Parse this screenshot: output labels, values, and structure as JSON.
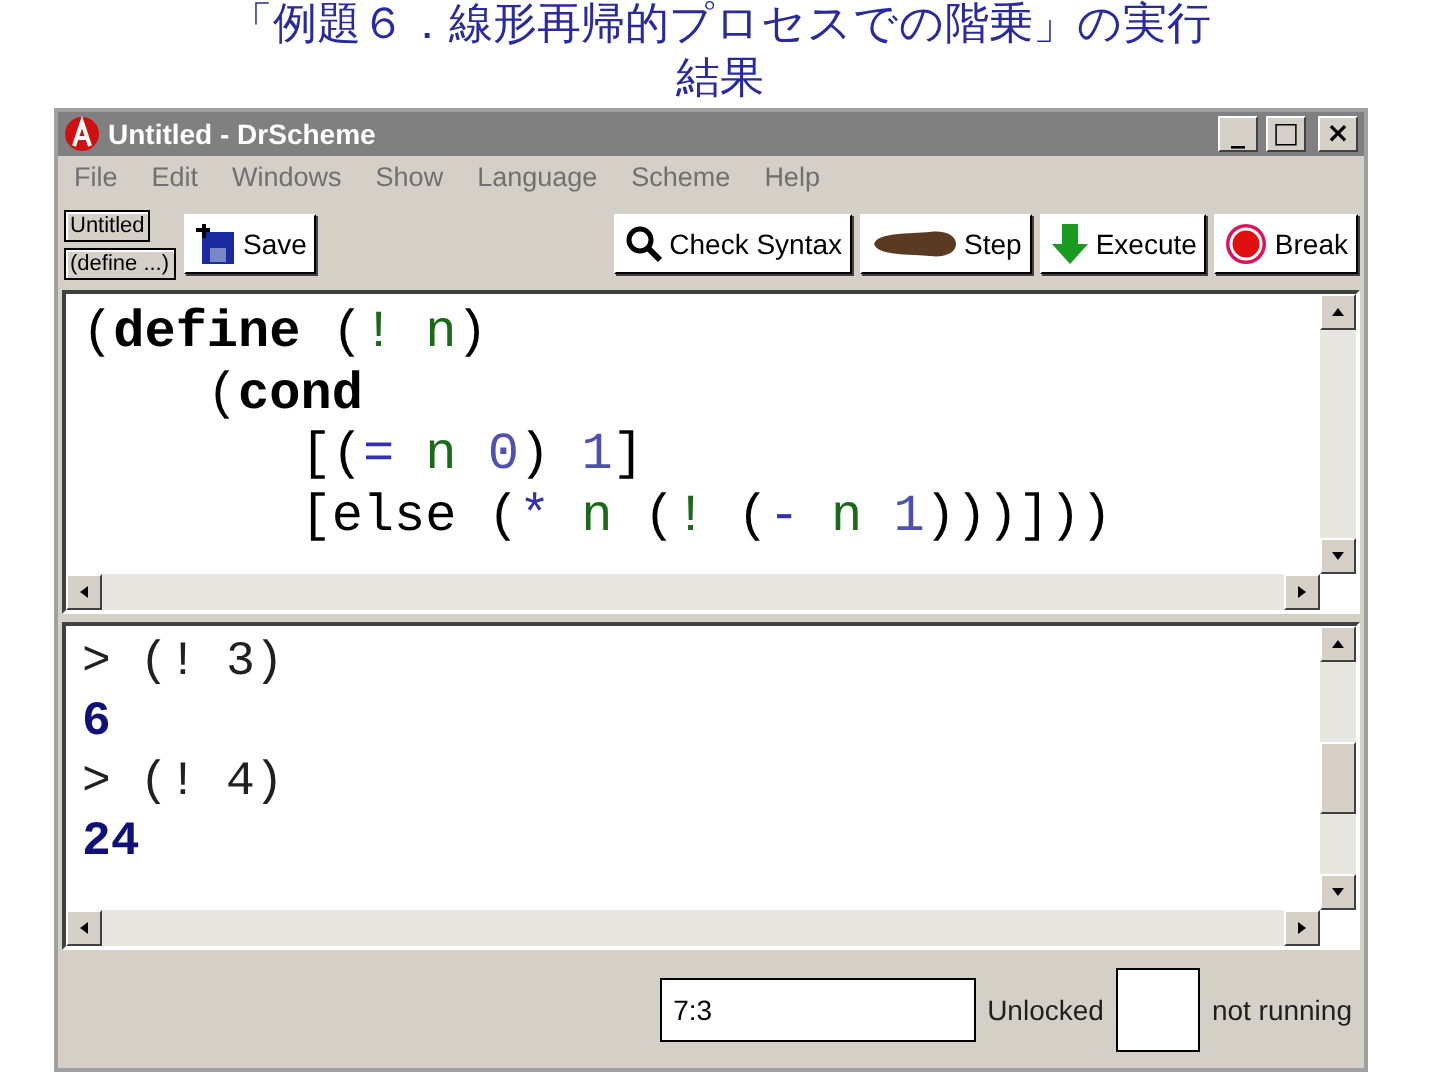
{
  "slide_title": [
    "「例題６．線形再帰的プロセスでの階乗」の実行",
    "結果"
  ],
  "window": {
    "title": "Untitled - DrScheme",
    "controls": [
      {
        "kind": "minimize",
        "label": "_"
      },
      {
        "kind": "maximize",
        "label": "□"
      },
      {
        "kind": "close",
        "label": "×"
      }
    ]
  },
  "menu": [
    {
      "label": "File"
    },
    {
      "label": "Edit"
    },
    {
      "label": "Windows"
    },
    {
      "label": "Show"
    },
    {
      "label": "Language"
    },
    {
      "label": "Scheme"
    },
    {
      "label": "Help"
    }
  ],
  "toolbar": {
    "name_button": "Untitled",
    "define_button": "(define ...)",
    "buttons": [
      {
        "kind": "save",
        "label": "Save"
      },
      {
        "kind": "check",
        "label": "Check Syntax"
      },
      {
        "kind": "step",
        "label": "Step"
      },
      {
        "kind": "execute",
        "label": "Execute"
      },
      {
        "kind": "break",
        "label": "Break"
      }
    ]
  },
  "editor": {
    "lines": [
      [
        {
          "text": "(",
          "kind": "paren"
        },
        {
          "text": "define",
          "kind": "keyword"
        },
        {
          "text": " (",
          "kind": "paren"
        },
        {
          "text": "! n",
          "kind": "variable"
        },
        {
          "text": ")",
          "kind": "paren"
        }
      ],
      [
        {
          "text": "    (",
          "kind": "paren"
        },
        {
          "text": "cond",
          "kind": "keyword"
        }
      ],
      [
        {
          "text": "       [(",
          "kind": "paren"
        },
        {
          "text": "=",
          "kind": "primitive"
        },
        {
          "text": " n ",
          "kind": "variable"
        },
        {
          "text": "0",
          "kind": "constant"
        },
        {
          "text": ") ",
          "kind": "paren"
        },
        {
          "text": "1",
          "kind": "constant"
        },
        {
          "text": "]",
          "kind": "paren"
        }
      ],
      [
        {
          "text": "       [else (",
          "kind": "paren"
        },
        {
          "text": "*",
          "kind": "primitive"
        },
        {
          "text": " n ",
          "kind": "variable"
        },
        {
          "text": "(",
          "kind": "paren"
        },
        {
          "text": "!",
          "kind": "variable"
        },
        {
          "text": " (",
          "kind": "paren"
        },
        {
          "text": "-",
          "kind": "primitive"
        },
        {
          "text": " n ",
          "kind": "variable"
        },
        {
          "text": "1",
          "kind": "constant"
        },
        {
          "text": ")))]))",
          "kind": "paren"
        }
      ]
    ]
  },
  "interactions": [
    {
      "kind": "input",
      "text": "> (! 3)"
    },
    {
      "kind": "output",
      "text": "6"
    },
    {
      "kind": "input",
      "text": "> (! 4)"
    },
    {
      "kind": "output",
      "text": "24"
    }
  ],
  "status_bar": {
    "position": "7:3",
    "lock": "Unlocked",
    "state": "not running"
  }
}
